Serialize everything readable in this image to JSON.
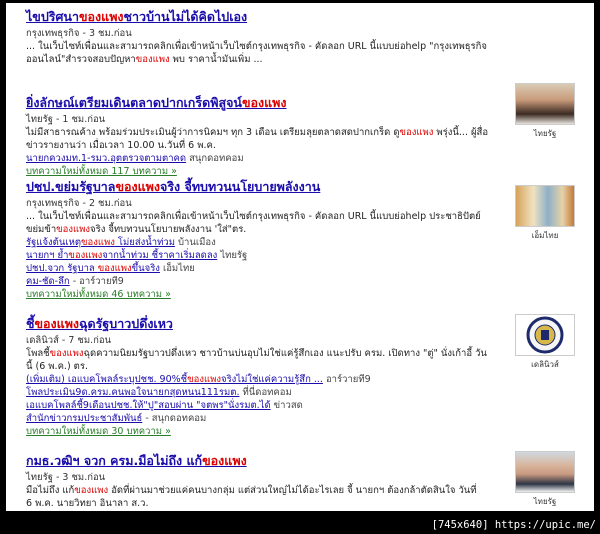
{
  "results": [
    {
      "title_a": "ไขปริศนา",
      "title_hl": "ของแพง",
      "title_b": "ชาวบ้านไม่ได้คิดไปเอง",
      "source": "กรุงเทพธุรกิจ",
      "time": "3 ชม.ก่อน",
      "snippet_1": "... ในเว็บไซท์เพื่อนและสามารถคลิกเพื่อเข้าหน้าเว็บไซต์กรุงเทพธุรกิจ - คัดลอก URL นี้แบบย่อhelp \"กรุงเทพธุรกิจ",
      "snippet_2a": "ออนไลน์\"สำรวจสอบปัญหา",
      "snippet_2hl": "ของแพง",
      "snippet_2b": " พบ ราคาน้ำมันเพิ่ม ..."
    },
    {
      "title_a": "ยิ่งลักษณ์เตรียมเดินตลาดปากเกร็ดพิสูจน์",
      "title_hl": "ของแพง",
      "title_b": "",
      "source": "ไทยรัฐ",
      "time": "1 ชม.ก่อน",
      "snippet_1a": "ไม่มีสาธารณค้าง พร้อมร่วมประเมินผู้ว่าการนิคมฯ ทุก 3 เดือน เตรียมลุยตลาดสดปากเกร็ด ดู",
      "snippet_1hl": "ของแพง",
      "snippet_1b": " พรุ่งนี้... ผู้สื่อ",
      "snippet_2": "ข่าวรายงานว่า เมื่อเวลา 10.00 น.วันที่ 6 พ.ค.",
      "related": [
        {
          "link": "นายกควงมท.1-รมว.อุตตรวจตามตาคด",
          "source": "สนุกดอทคอม"
        }
      ],
      "more": "บทความใหม่ทั้งหมด 117 บทความ »",
      "thumb_caption": "ไทยรัฐ"
    },
    {
      "title_a": "ปชป.ขย่มรัฐบาล",
      "title_hl": "ของแพง",
      "title_b": "จริง จี้ทบทวนนโยบายพลังงาน",
      "source": "กรุงเทพธุรกิจ",
      "time": "2 ชม.ก่อน",
      "snippet_1": "... ในเว็บไซท์เพื่อนและสามารถคลิกเพื่อเข้าหน้าเว็บไซต์กรุงเทพธุรกิจ - คัดลอก URL นี้แบบย่อhelp ประชาธิปัตย์",
      "snippet_2a": "ขย่มข้า",
      "snippet_2hl": "ของแพง",
      "snippet_2b": "จริง จี้ทบทวนนโยบายพลังงาน 'ใส่\"ตร.",
      "related": [
        {
          "link_a": "รัฐแจ้งต้นเหตุ",
          "link_hl": "ของแพง",
          "link_b": " โม่ยส่งน้ำท่วม",
          "source": "บ้านเมือง"
        },
        {
          "link_a": "นายกฯ ย้ำ",
          "link_hl": "ของแพง",
          "link_b": "จากน้ำท่วม ชี้ราคาเริ่มลดลง",
          "source": "ไทยรัฐ"
        },
        {
          "link_a": "ปชป.จวก รัฐบาล ",
          "link_hl": "ของแพง",
          "link_b": "ขึ้นจริง",
          "source": "เอ็มไทย"
        },
        {
          "link_a": "คม-ชัด-ลึก",
          "link_hl": "",
          "link_b": " - อาร์วายที9",
          "source": ""
        }
      ],
      "more": "บทความใหม่ทั้งหมด 46 บทความ »",
      "thumb_caption": "เอ็มไทย"
    },
    {
      "title_a": "ชี้",
      "title_hl": "ของแพง",
      "title_b": "ฉุดรัฐบาวปดึ่งเหว",
      "source": "เดลินิวส์",
      "time": "7 ชม.ก่อน",
      "snippet_1a": "โพลชี้",
      "snippet_1hl": "ของแพง",
      "snippet_1b": "ฉุดความนิยมรัฐบาวปดึ่งเหว ชาวบ้านบ่นอุบไม่ใช่แค่รู้สึกเอง แนะปรับ ครม. เปิดทาง \"ตู่\" นั่งเก้าอี้ วัน",
      "snippet_2": "นี้ (6 พ.ค.) ตร.",
      "related": [
        {
          "link_a": "(เพิ่มเติม) เอแบคโพลล์ระบุปชช. 90%ชี้",
          "link_hl": "ของแพง",
          "link_b": "จริงไม่ใช่แค่ความรู้สึก ...",
          "source": "อาร์วายที9"
        },
        {
          "link_a": "โพลประเมิน9ด.ครม.คนพอใจนายกสุดหนน111รมต.",
          "link_hl": "",
          "link_b": "",
          "source": "ที่นี่ดอทคอม"
        },
        {
          "link_a": "เอแบคโพลล์ชี้9เดือนปชช.ให้\"ปู\"สอบผ่าน \"จตพร\"นั่งรมต.ได้",
          "link_hl": "",
          "link_b": "",
          "source": "ข่าวสด"
        },
        {
          "link_a": "สำนักข่าวกรมประชาสัมพันธ์",
          "link_hl": "",
          "link_b": " - สนุกดอทคอม",
          "source": ""
        }
      ],
      "more": "บทความใหม่ทั้งหมด 30 บทความ »",
      "thumb_caption": "เดลินิวส์"
    },
    {
      "title_a": "กมธ.วฒิฯ จวก ครม.มือไม่ถึง แก้",
      "title_hl": "ของแพง",
      "title_b": "",
      "source": "ไทยรัฐ",
      "time": "3 ชม.ก่อน",
      "snippet_1a": "มือไม่ถึง แก้",
      "snippet_1hl": "ของแพง",
      "snippet_1b": " อัดที่ผ่านมาช่วยแค่คนบางกลุ่ม แต่ส่วนใหญ่ไม่ได้อะไรเลย จี้ นายกฯ ต้องกล้าตัดสินใจ วันที่",
      "snippet_2": "6 พ.ค. นายวิทยา อินาลา ส.ว.",
      "thumb_caption": "ไทยรัฐ"
    }
  ],
  "footer": "[745x640] https://upic.me/"
}
